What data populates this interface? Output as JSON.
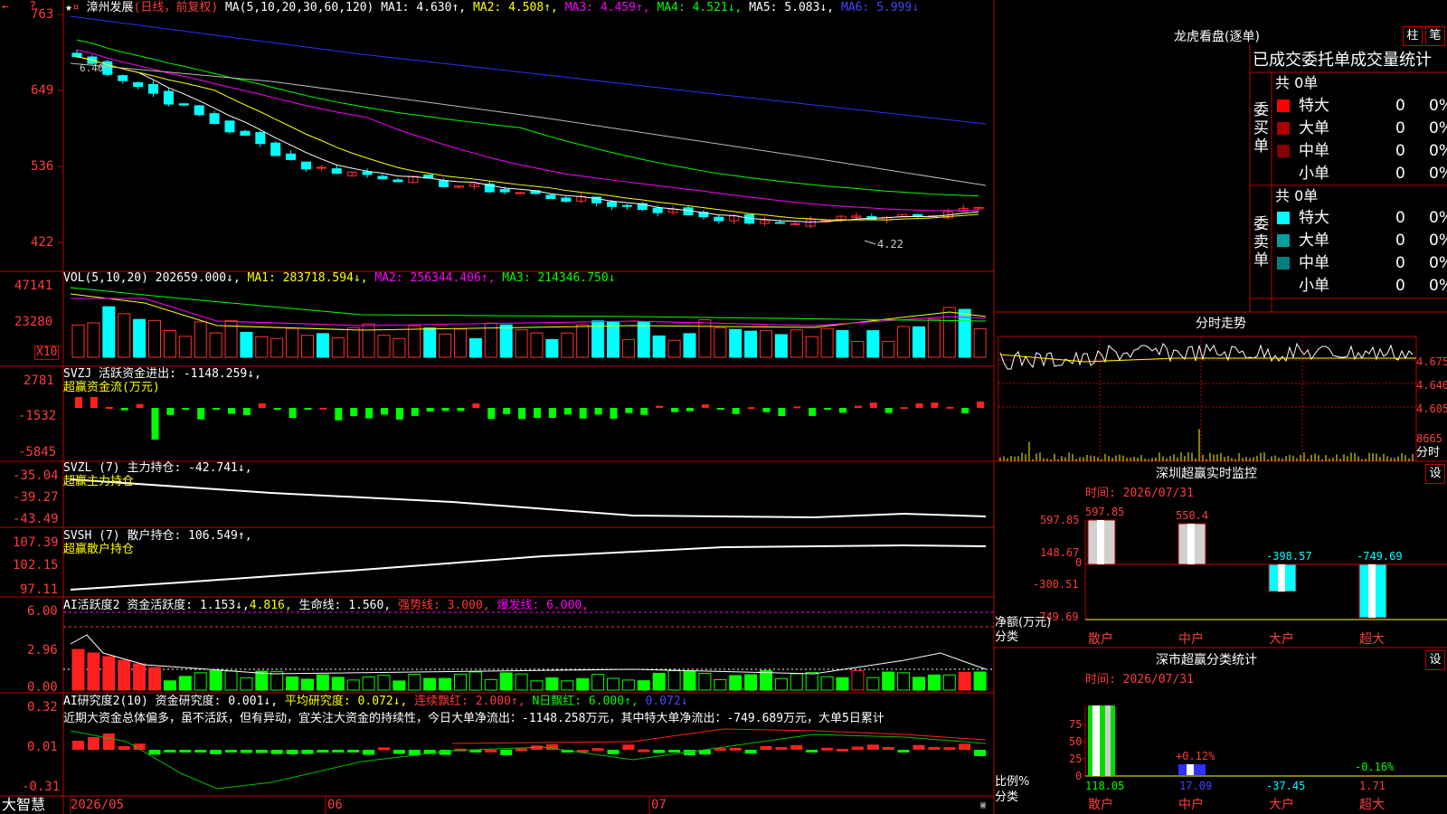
{
  "header": {
    "stock_name": "漳州发展",
    "period": "(日线，前复权)",
    "ma_label": "MA(5,10,20,30,60,120)",
    "ma1": "MA1: 4.630↑,",
    "ma2": "MA2: 4.508↑,",
    "ma3": "MA3: 4.459↑,",
    "ma4": "MA4: 4.521↓,",
    "ma5": "MA5: 5.083↓,",
    "ma6": "MA6: 5.999↓"
  },
  "price_axis": [
    "763",
    "649",
    "536",
    "422"
  ],
  "price_annotation_high": "6.40",
  "price_annotation_low": "4.22",
  "vol_panel": {
    "title": "VOL(5,10,20)",
    "value": "202659.000↓,",
    "ma1": "MA1: 283718.594↓,",
    "ma2": "MA2: 256344.406↑,",
    "ma3": "MA3: 214346.750↓",
    "axis": [
      "47141",
      "23280"
    ],
    "unit": "X10"
  },
  "svzj_panel": {
    "title": "SVZJ  活跃资金进出: -1148.259↓,",
    "subtitle": "超赢资金流(万元)",
    "axis": [
      "2781",
      "-1532",
      "-5845"
    ]
  },
  "svzl_panel": {
    "title": "SVZL (7) 主力持仓: -42.741↓,",
    "subtitle": "超赢主力持仓",
    "axis": [
      "-35.04",
      "-39.27",
      "-43.49"
    ]
  },
  "svsh_panel": {
    "title": "SVSH (7) 散户持仓: 106.549↑,",
    "subtitle": "超赢散户持仓",
    "axis": [
      "107.39",
      "102.15",
      "97.11"
    ]
  },
  "ai_active_panel": {
    "t1": "AI活跃度2 资金活跃度: 1.153↓,",
    "t2": "4.816,",
    "t3": "生命线: 1.560,",
    "t4": "强势线: 3.000,",
    "t5": "爆发线: 6.000,",
    "axis": [
      "6.00",
      "2.96",
      "0.00"
    ]
  },
  "ai_research_panel": {
    "t1": "AI研究度2(10) 资金研究度: 0.001↓,",
    "t2": "平均研究度: 0.072↓,",
    "t3": "连续飘红: 2.000↑,",
    "t4": "N日飘红: 6.000↑,",
    "t5": "0.072↓",
    "commentary": "近期大资金总体偏多，虽不活跃，但有异动，宜关注大资金的持续性，今日大单净流出：-1148.258万元，其中特大单净流出：-749.689万元，大单5日累计",
    "axis": [
      "0.32",
      "0.01",
      "-0.31"
    ]
  },
  "date_axis": {
    "brand": "大智慧",
    "d1": "2026/05",
    "d2": "06",
    "d3": "07"
  },
  "longhu": {
    "title": "龙虎看盘(逐单)",
    "btn1": "柱",
    "btn2": "笔",
    "section_title": "已成交委托单成交量统计",
    "buy_label": "委买单",
    "sell_label": "委卖单",
    "buy_total": "共 0单",
    "sell_total": "共 0单",
    "buy_rows": [
      {
        "name": "特大",
        "count": "0",
        "pct": "0%",
        "color": "#ff0000"
      },
      {
        "name": "大单",
        "count": "0",
        "pct": "0%",
        "color": "#aa0000"
      },
      {
        "name": "中单",
        "count": "0",
        "pct": "0%",
        "color": "#880000"
      },
      {
        "name": "小单",
        "count": "0",
        "pct": "0%",
        "color": "#000000"
      }
    ],
    "sell_rows": [
      {
        "name": "特大",
        "count": "0",
        "pct": "0%",
        "color": "#00ffff"
      },
      {
        "name": "大单",
        "count": "0",
        "pct": "0%",
        "color": "#00a0a0"
      },
      {
        "name": "中单",
        "count": "0",
        "pct": "0%",
        "color": "#008080"
      },
      {
        "name": "小单",
        "count": "0",
        "pct": "0%",
        "color": "#000000"
      }
    ]
  },
  "intraday": {
    "title": "分时走势",
    "axis": [
      "4.675",
      "4.640",
      "4.605",
      "8665"
    ],
    "time_label": "分时"
  },
  "monitor": {
    "title": "深圳超赢实时监控",
    "btn": "设",
    "time": "时间: 2026/07/31",
    "axis": [
      "597.85",
      "148.67",
      "0",
      "-300.51",
      "-749.69"
    ],
    "net_label": "净额(万元)",
    "class_label": "分类",
    "categories": [
      "散户",
      "中户",
      "大户",
      "超大"
    ],
    "values": [
      "597.85",
      "550.4",
      "-398.57",
      "-749.69"
    ]
  },
  "classify": {
    "title": "深市超赢分类统计",
    "btn": "设",
    "time": "时间: 2026/07/31",
    "axis": [
      "75",
      "50",
      "25",
      "0"
    ],
    "ratio_label": "比例%",
    "class_label": "分类",
    "pct_labels": [
      "+0.12%",
      "-0.16%"
    ],
    "values": [
      "118.05",
      "17.09",
      "-37.45",
      "1.71"
    ],
    "categories": [
      "散户",
      "中户",
      "大户",
      "超大"
    ]
  }
}
